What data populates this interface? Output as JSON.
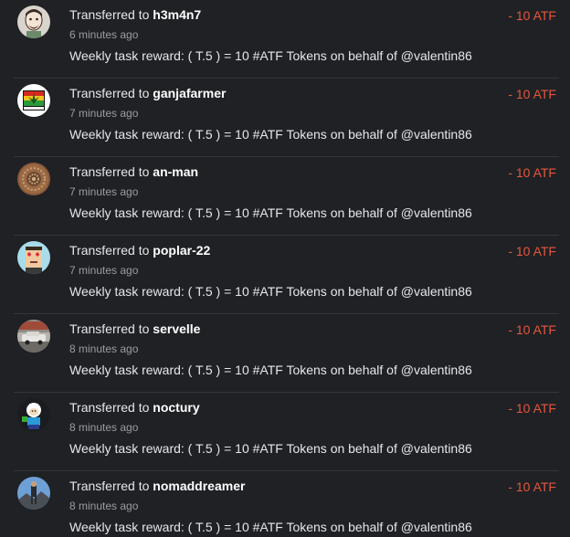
{
  "colors": {
    "background": "#1f2125",
    "amount_negative": "#e8563c",
    "divider": "#33363b"
  },
  "transactions": [
    {
      "prefix": "Transferred to ",
      "user": "h3m4n7",
      "time": "6 minutes ago",
      "memo": "Weekly task reward: ( T.5 ) = 10 #ATF Tokens on behalf of @valentin86",
      "amount": "- 10 ATF",
      "avatar_icon": "cartoon-face-avatar"
    },
    {
      "prefix": "Transferred to ",
      "user": "ganjafarmer",
      "time": "7 minutes ago",
      "memo": "Weekly task reward: ( T.5 ) = 10 #ATF Tokens on behalf of @valentin86",
      "amount": "- 10 ATF",
      "avatar_icon": "leaf-logo-avatar"
    },
    {
      "prefix": "Transferred to ",
      "user": "an-man",
      "time": "7 minutes ago",
      "memo": "Weekly task reward: ( T.5 ) = 10 #ATF Tokens on behalf of @valentin86",
      "amount": "- 10 ATF",
      "avatar_icon": "mandala-avatar"
    },
    {
      "prefix": "Transferred to ",
      "user": "poplar-22",
      "time": "7 minutes ago",
      "memo": "Weekly task reward: ( T.5 ) = 10 #ATF Tokens on behalf of @valentin86",
      "amount": "- 10 ATF",
      "avatar_icon": "pixel-heart-eyes-avatar"
    },
    {
      "prefix": "Transferred to ",
      "user": "servelle",
      "time": "8 minutes ago",
      "memo": "Weekly task reward: ( T.5 ) = 10 #ATF Tokens on behalf of @valentin86",
      "amount": "- 10 ATF",
      "avatar_icon": "car-photo-avatar"
    },
    {
      "prefix": "Transferred to ",
      "user": "noctury",
      "time": "8 minutes ago",
      "memo": "Weekly task reward: ( T.5 ) = 10 #ATF Tokens on behalf of @valentin86",
      "amount": "- 10 ATF",
      "avatar_icon": "cartoon-character-avatar"
    },
    {
      "prefix": "Transferred to ",
      "user": "nomaddreamer",
      "time": "8 minutes ago",
      "memo": "Weekly task reward: ( T.5 ) = 10 #ATF Tokens on behalf of @valentin86",
      "amount": "- 10 ATF",
      "avatar_icon": "mountain-photo-avatar"
    }
  ]
}
